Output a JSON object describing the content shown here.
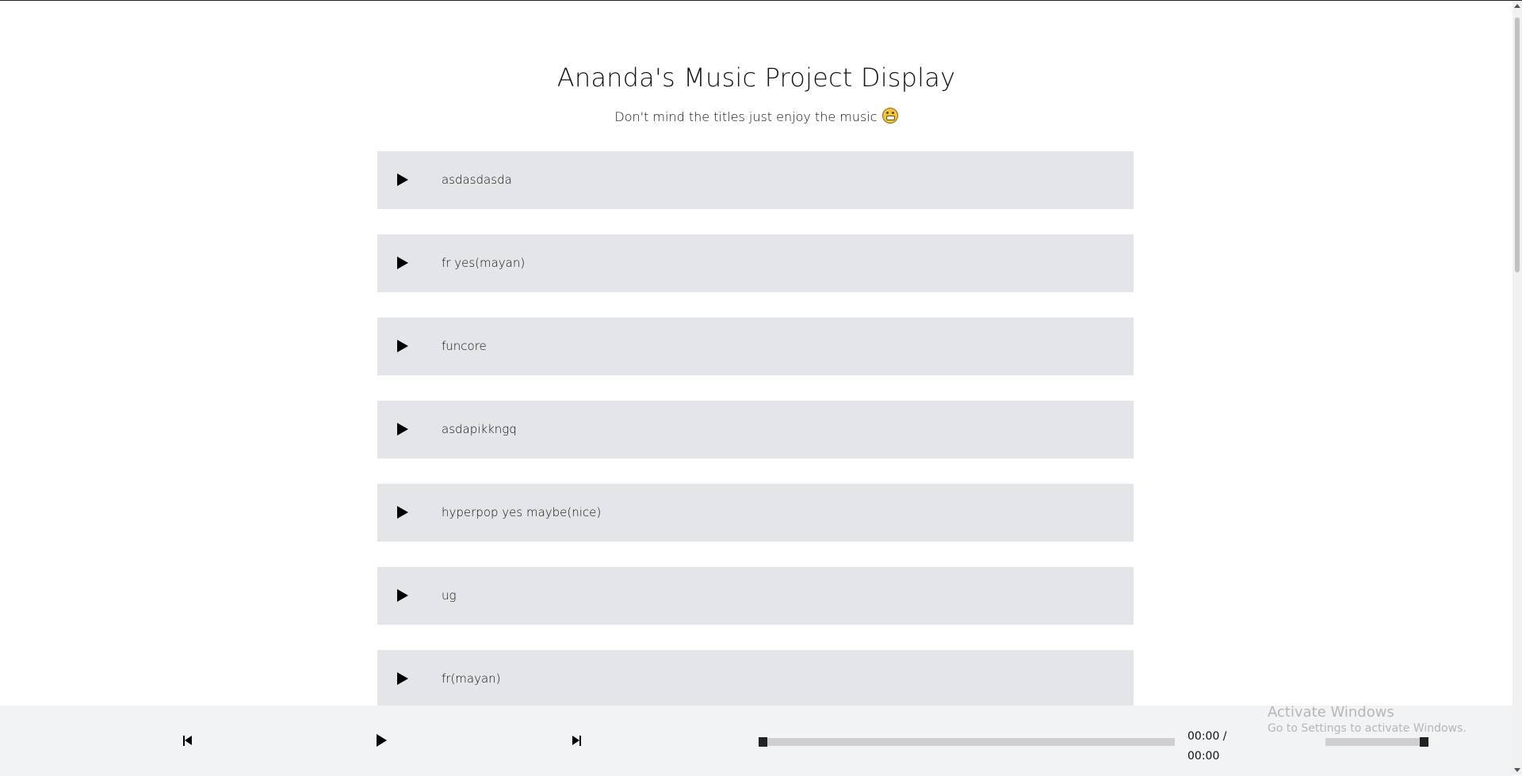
{
  "header": {
    "title": "Ananda's Music Project Display",
    "subtitle": "Don't mind the titles just enjoy the music"
  },
  "songs": [
    {
      "title": "asdasdasda"
    },
    {
      "title": "fr yes(mayan)"
    },
    {
      "title": "funcore"
    },
    {
      "title": "asdapikkngq"
    },
    {
      "title": "hyperpop yes maybe(nice)"
    },
    {
      "title": "ug"
    },
    {
      "title": "fr(mayan)"
    }
  ],
  "player": {
    "current_time": "00:00 /",
    "duration": "00:00",
    "progress": 0,
    "volume": 1.0
  },
  "watermark": {
    "line1": "Activate Windows",
    "line2": "Go to Settings to activate Windows."
  },
  "colors": {
    "song_row_bg": "#e4e5e9",
    "player_bg": "#f2f3f5",
    "track_bg": "#cfcfd2"
  }
}
